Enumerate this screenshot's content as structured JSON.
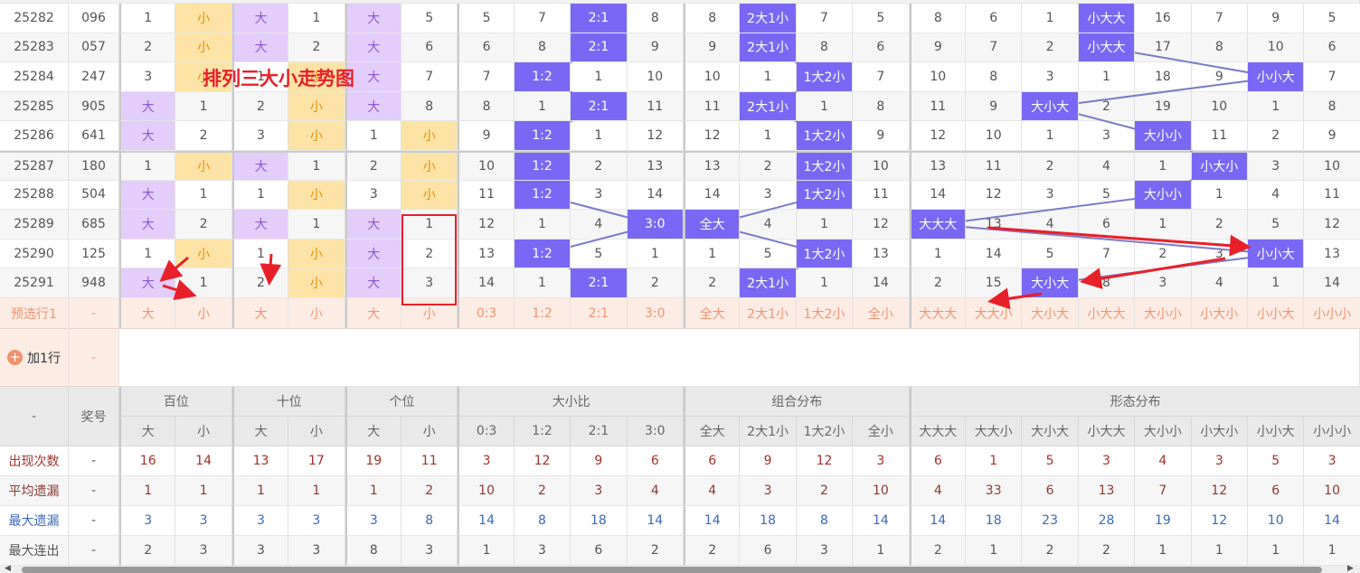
{
  "title_overlay": "排列三大小走势图",
  "groups": [
    {
      "label": "百位",
      "span": 2
    },
    {
      "label": "十位",
      "span": 2
    },
    {
      "label": "个位",
      "span": 2
    },
    {
      "label": "大小比",
      "span": 4
    },
    {
      "label": "组合分布",
      "span": 4
    },
    {
      "label": "形态分布",
      "span": 8
    }
  ],
  "sub_headers": [
    "大",
    "小",
    "大",
    "小",
    "大",
    "小",
    "0:3",
    "1:2",
    "2:1",
    "3:0",
    "全大",
    "2大1小",
    "1大2小",
    "全小",
    "大大大",
    "大大小",
    "大小大",
    "小大大",
    "大小小",
    "小大小",
    "小小大",
    "小小小"
  ],
  "header_corner": "-",
  "header_number": "奖号",
  "rows": [
    {
      "period": "25282",
      "number": "096",
      "cells": [
        "1",
        "小",
        "大",
        "1",
        "大",
        "5",
        "5",
        "7",
        "2:1",
        "8",
        "8",
        "2大1小",
        "7",
        "5",
        "8",
        "6",
        "1",
        "小大大",
        "16",
        "7",
        "9",
        "5"
      ]
    },
    {
      "period": "25283",
      "number": "057",
      "cells": [
        "2",
        "小",
        "大",
        "2",
        "大",
        "6",
        "6",
        "8",
        "2:1",
        "9",
        "9",
        "2大1小",
        "8",
        "6",
        "9",
        "7",
        "2",
        "小大大",
        "17",
        "8",
        "10",
        "6"
      ]
    },
    {
      "period": "25284",
      "number": "247",
      "cells": [
        "3",
        "小",
        "1",
        "小",
        "大",
        "7",
        "7",
        "1:2",
        "1",
        "10",
        "10",
        "1",
        "1大2小",
        "7",
        "10",
        "8",
        "3",
        "1",
        "18",
        "9",
        "小小大",
        "7"
      ]
    },
    {
      "period": "25285",
      "number": "905",
      "cells": [
        "大",
        "1",
        "2",
        "小",
        "大",
        "8",
        "8",
        "1",
        "2:1",
        "11",
        "11",
        "2大1小",
        "1",
        "8",
        "11",
        "9",
        "大小大",
        "2",
        "19",
        "10",
        "1",
        "8"
      ]
    },
    {
      "period": "25286",
      "number": "641",
      "cells": [
        "大",
        "2",
        "3",
        "小",
        "1",
        "小",
        "9",
        "1:2",
        "1",
        "12",
        "12",
        "1",
        "1大2小",
        "9",
        "12",
        "10",
        "1",
        "3",
        "大小小",
        "11",
        "2",
        "9"
      ]
    },
    {
      "period": "25287",
      "number": "180",
      "cells": [
        "1",
        "小",
        "大",
        "1",
        "2",
        "小",
        "10",
        "1:2",
        "2",
        "13",
        "13",
        "2",
        "1大2小",
        "10",
        "13",
        "11",
        "2",
        "4",
        "1",
        "小大小",
        "3",
        "10"
      ]
    },
    {
      "period": "25288",
      "number": "504",
      "cells": [
        "大",
        "1",
        "1",
        "小",
        "3",
        "小",
        "11",
        "1:2",
        "3",
        "14",
        "14",
        "3",
        "1大2小",
        "11",
        "14",
        "12",
        "3",
        "5",
        "大小小",
        "1",
        "4",
        "11"
      ]
    },
    {
      "period": "25289",
      "number": "685",
      "cells": [
        "大",
        "2",
        "大",
        "1",
        "大",
        "1",
        "12",
        "1",
        "4",
        "3:0",
        "全大",
        "4",
        "1",
        "12",
        "大大大",
        "13",
        "4",
        "6",
        "1",
        "2",
        "5",
        "12"
      ]
    },
    {
      "period": "25290",
      "number": "125",
      "cells": [
        "1",
        "小",
        "1",
        "小",
        "大",
        "2",
        "13",
        "1:2",
        "5",
        "1",
        "1",
        "5",
        "1大2小",
        "13",
        "1",
        "14",
        "5",
        "7",
        "2",
        "3",
        "小小大",
        "13"
      ]
    },
    {
      "period": "25291",
      "number": "948",
      "cells": [
        "大",
        "1",
        "2",
        "小",
        "大",
        "3",
        "14",
        "1",
        "2:1",
        "2",
        "2",
        "2大1小",
        "1",
        "14",
        "2",
        "15",
        "大小大",
        "8",
        "3",
        "4",
        "1",
        "14"
      ]
    }
  ],
  "preselect": {
    "label": "预选行1",
    "number": "-",
    "cells": [
      "大",
      "小",
      "大",
      "小",
      "大",
      "小",
      "0:3",
      "1:2",
      "2:1",
      "3:0",
      "全大",
      "2大1小",
      "1大2小",
      "全小",
      "大大大",
      "大大小",
      "大小大",
      "小大大",
      "大小小",
      "小大小",
      "小小大",
      "小小小"
    ]
  },
  "add_row": {
    "label": "加1行",
    "number": "-",
    "icon": "plus-circle-icon"
  },
  "stats": [
    {
      "key": "count",
      "label": "出现次数",
      "number": "-",
      "values": [
        "16",
        "14",
        "13",
        "17",
        "19",
        "11",
        "3",
        "12",
        "9",
        "6",
        "6",
        "9",
        "12",
        "3",
        "6",
        "1",
        "5",
        "3",
        "4",
        "3",
        "5",
        "3"
      ]
    },
    {
      "key": "avg",
      "label": "平均遗漏",
      "number": "-",
      "values": [
        "1",
        "1",
        "1",
        "1",
        "1",
        "2",
        "10",
        "2",
        "3",
        "4",
        "4",
        "3",
        "2",
        "10",
        "4",
        "33",
        "6",
        "13",
        "7",
        "12",
        "6",
        "10"
      ]
    },
    {
      "key": "max",
      "label": "最大遗漏",
      "number": "-",
      "values": [
        "3",
        "3",
        "3",
        "3",
        "3",
        "8",
        "14",
        "8",
        "18",
        "14",
        "14",
        "18",
        "8",
        "14",
        "14",
        "18",
        "23",
        "28",
        "19",
        "12",
        "10",
        "14"
      ]
    },
    {
      "key": "run",
      "label": "最大连出",
      "number": "-",
      "values": [
        "2",
        "3",
        "3",
        "3",
        "8",
        "3",
        "1",
        "3",
        "6",
        "2",
        "2",
        "6",
        "3",
        "1",
        "2",
        "1",
        "2",
        "2",
        "1",
        "1",
        "1",
        "1"
      ]
    }
  ],
  "colors": {
    "big_bg": "#e3cdfb",
    "small_bg": "#fde4a6",
    "hit_bg": "#7a68f5",
    "line": "#7b7bc8",
    "annotation": "#e8202a"
  }
}
